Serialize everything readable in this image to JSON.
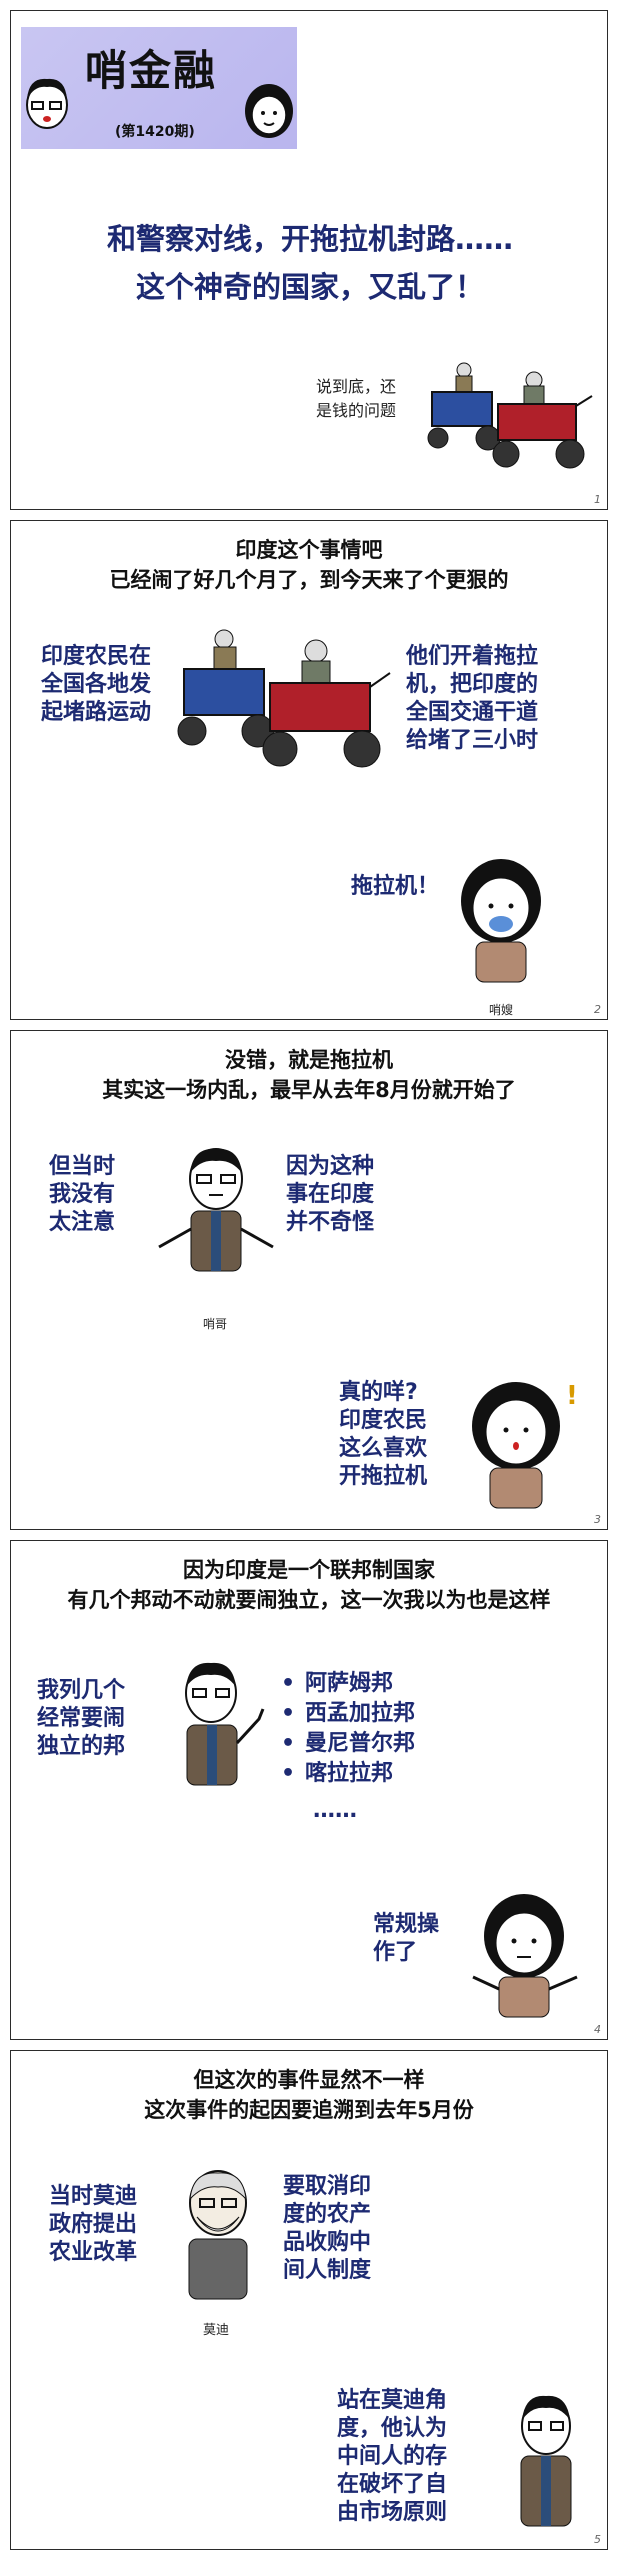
{
  "header": {
    "title": "哨金融",
    "issue": "(第1420期)"
  },
  "panel1": {
    "headline_line1": "和警察对线，开拖拉机封路……",
    "headline_line2": "这个神奇的国家，又乱了！",
    "caption_line1": "说到底，还",
    "caption_line2": "是钱的问题",
    "page": "1"
  },
  "panel2": {
    "line1": "印度这个事情吧",
    "line2": "已经闹了好几个月了，到今天来了个更狠的",
    "left_1": "印度农民在",
    "left_2": "全国各地发",
    "left_3": "起堵路运动",
    "right_1": "他们开着拖拉",
    "right_2": "机，把印度的",
    "right_3": "全国交通干道",
    "right_4": "给堵了三小时",
    "reply": "拖拉机！",
    "name": "哨嫂",
    "page": "2"
  },
  "panel3": {
    "line1": "没错，就是拖拉机",
    "line2": "其实这一场内乱，最早从去年8月份就开始了",
    "left_1": "但当时",
    "left_2": "我没有",
    "left_3": "太注意",
    "right_1": "因为这种",
    "right_2": "事在印度",
    "right_3": "并不奇怪",
    "name": "哨哥",
    "reply_1": "真的咩?",
    "reply_2": "印度农民",
    "reply_3": "这么喜欢",
    "reply_4": "开拖拉机",
    "page": "3"
  },
  "panel4": {
    "line1": "因为印度是一个联邦制国家",
    "line2": "有几个邦动不动就要闹独立，这一次我以为也是这样",
    "left_1": "我列几个",
    "left_2": "经常要闹",
    "left_3": "独立的邦",
    "states": [
      "阿萨姆邦",
      "西孟加拉邦",
      "曼尼普尔邦",
      "喀拉拉邦"
    ],
    "ellipsis": "……",
    "reply_1": "常规操",
    "reply_2": "作了",
    "page": "4"
  },
  "panel5": {
    "line1": "但这次的事件显然不一样",
    "line2": "这次事件的起因要追溯到去年5月份",
    "left_1": "当时莫迪",
    "left_2": "政府提出",
    "left_3": "农业改革",
    "right_1": "要取消印",
    "right_2": "度的农产",
    "right_3": "品收购中",
    "right_4": "间人制度",
    "name": "莫迪",
    "bottom_1": "站在莫迪角",
    "bottom_2": "度，他认为",
    "bottom_3": "中间人的存",
    "bottom_4": "在破坏了自",
    "bottom_5": "由市场原则",
    "page": "5"
  },
  "colors": {
    "headline": "#1d2a72",
    "header_bg": "#bdb9ef",
    "tractor_blue": "#2c4fa0",
    "tractor_red": "#b0202a"
  }
}
